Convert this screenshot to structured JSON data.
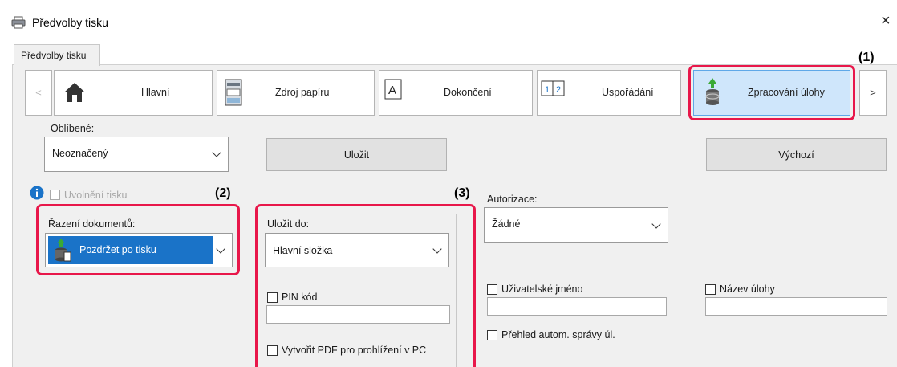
{
  "window": {
    "title": "Předvolby tisku",
    "close": "×"
  },
  "tab": {
    "label": "Předvolby tisku"
  },
  "nav": {
    "prev": "≤",
    "next": "≥",
    "items": [
      {
        "label": "Hlavní",
        "icon": "home-icon"
      },
      {
        "label": "Zdroj papíru",
        "icon": "printer-paper-icon"
      },
      {
        "label": "Dokončení",
        "icon": "finishing-icon"
      },
      {
        "label": "Uspořádání",
        "icon": "layout-icon"
      },
      {
        "label": "Zpracování úlohy",
        "icon": "job-handling-icon",
        "selected": true
      }
    ]
  },
  "favorites": {
    "label": "Oblíbené:",
    "value": "Neoznačený",
    "save": "Uložit",
    "default": "Výchozí"
  },
  "release": {
    "label": "Uvolnění tisku",
    "checked": false
  },
  "retention": {
    "label": "Řazení dokumentů:",
    "value": "Pozdržet po tisku"
  },
  "store": {
    "label": "Uložit do:",
    "value": "Hlavní složka",
    "pin_label": "PIN kód",
    "pin_value": "",
    "pdf_label": "Vytvořit PDF pro prohlížení v PC"
  },
  "auth": {
    "label": "Autorizace:",
    "value": "Žádné",
    "username_label": "Uživatelské jméno",
    "username_value": "",
    "jobname_label": "Název úlohy",
    "jobname_value": "",
    "auto_job_label": "Přehled autom. správy úl."
  },
  "callouts": {
    "c1": "(1)",
    "c2": "(2)",
    "c3": "(3)"
  },
  "colors": {
    "highlight": "#e8174a",
    "selected_bg": "#cfe6fb",
    "accent_blue": "#1a73c8"
  }
}
